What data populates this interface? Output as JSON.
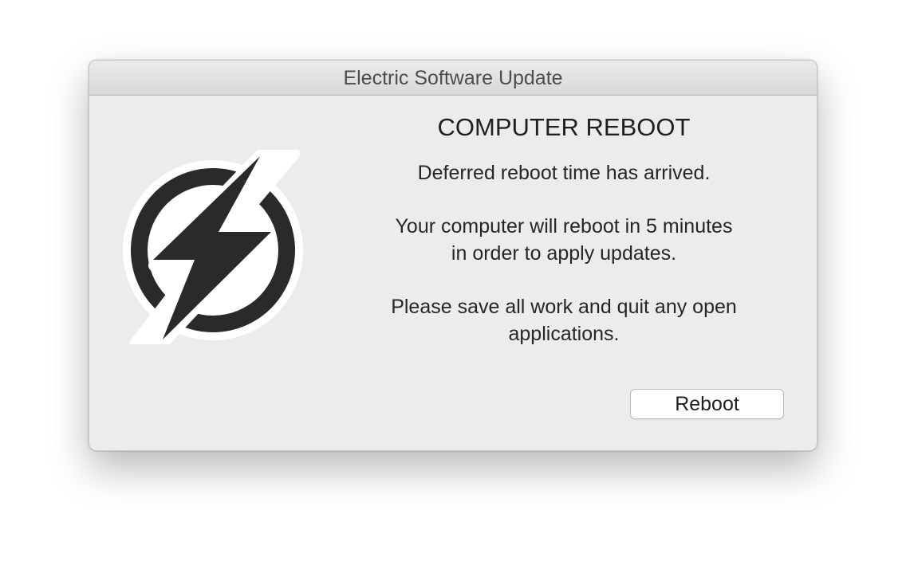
{
  "window": {
    "title": "Electric Software Update"
  },
  "icon": {
    "name": "lightning-bolt-icon",
    "color": "#2a2a2a"
  },
  "dialog": {
    "heading": "COMPUTER REBOOT",
    "message_1": "Deferred reboot time has arrived.",
    "message_2_line1": "Your computer will reboot in 5 minutes",
    "message_2_line2": "in order to apply updates.",
    "message_3_line1": "Please save all work and quit any open",
    "message_3_line2": "applications."
  },
  "buttons": {
    "reboot_label": "Reboot"
  }
}
